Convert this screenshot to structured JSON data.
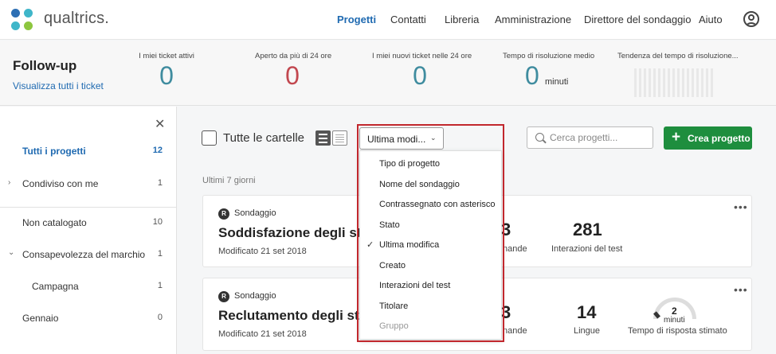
{
  "brand": {
    "name": "qualtrics."
  },
  "nav": {
    "items": [
      "Progetti",
      "Contatti",
      "Libreria",
      "Amministrazione",
      "Direttore del sondaggio",
      "Aiuto"
    ],
    "active": "Progetti"
  },
  "followup": {
    "title": "Follow-up",
    "link": "Visualizza tutti i ticket",
    "stats": [
      {
        "label": "I miei ticket attivi",
        "value": "0",
        "color": "#3f8c9f"
      },
      {
        "label": "Aperto da più di 24 ore",
        "value": "0",
        "color": "#c2474f"
      },
      {
        "label": "I miei nuovi ticket nelle 24 ore",
        "value": "0",
        "color": "#3f8c9f"
      },
      {
        "label": "Tempo di risoluzione medio",
        "value": "0",
        "color": "#3f8c9f"
      },
      {
        "label": "Tendenza del tempo di risoluzione..."
      }
    ],
    "unit": "minuti"
  },
  "sidebar": {
    "items": [
      {
        "label": "Tutti i progetti",
        "count": "12"
      },
      {
        "label": "Condiviso con me",
        "count": "1"
      },
      {
        "label": "Non catalogato",
        "count": "10"
      },
      {
        "label": "Consapevolezza del marchio",
        "count": "1"
      },
      {
        "label": "Campagna",
        "count": "1"
      },
      {
        "label": "Gennaio",
        "count": "0"
      }
    ]
  },
  "toolbar": {
    "all_folders": "Tutte le cartelle",
    "sort_value": "Ultima modi...",
    "search_placeholder": "Cerca progetti...",
    "create_label": "Crea progetto"
  },
  "period": "Ultimi 7 giorni",
  "cards": [
    {
      "type": "Sondaggio",
      "title": "Soddisfazione degli stu...",
      "modified": "Modificato 21 set 2018",
      "stats": [
        {
          "value": "3",
          "label": "nande"
        },
        {
          "value": "281",
          "label": "Interazioni del test"
        }
      ]
    },
    {
      "type": "Sondaggio",
      "title": "Reclutamento degli st...",
      "modified": "Modificato 21 set 2018",
      "stats": [
        {
          "value": "3",
          "label": "nande"
        },
        {
          "value": "14",
          "label": "Lingue"
        },
        {
          "value": "2",
          "label": "Tempo di risposta stimato",
          "unit": "minuti"
        }
      ]
    }
  ],
  "sort_menu": {
    "items": [
      "Tipo di progetto",
      "Nome del sondaggio",
      "Contrassegnato con asterisco",
      "Stato",
      "Ultima modifica",
      "Creato",
      "Interazioni del test",
      "Titolare",
      "Gruppo"
    ],
    "selected": "Ultima modifica",
    "disabled": "Gruppo"
  },
  "colors": {
    "accent": "#1f6ab1",
    "create": "#1e8e3e",
    "highlight": "#c1272d"
  }
}
